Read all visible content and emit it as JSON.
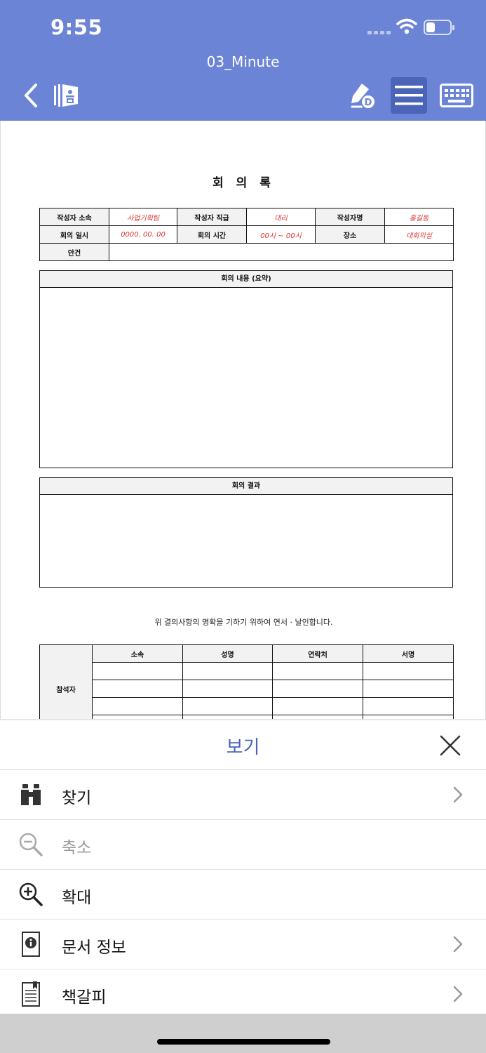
{
  "status_bar": {
    "time": "9:55",
    "battery_level": 0.35
  },
  "toolbar": {
    "document_title": "03_Minute"
  },
  "document": {
    "heading": "회 의 록",
    "info_table": {
      "row1": [
        "작성자 소속",
        "사업기획팀",
        "작성자 직급",
        "대리",
        "작성자명",
        "홍길동"
      ],
      "row2": [
        "회의 일시",
        "0000. 00. 00",
        "회의 시간",
        "00시 ~ 00시",
        "장소",
        "대회의실"
      ],
      "agenda_label": "안건"
    },
    "summary_header": "회의 내용 (요약)",
    "result_header": "회의 결과",
    "statement": "위 결의사항의 명확을 기하기 위하여 연서 · 날인합니다.",
    "attendee_table": {
      "label": "참석자",
      "headers": [
        "소속",
        "성명",
        "연락처",
        "서명"
      ]
    }
  },
  "sheet": {
    "title": "보기",
    "items": [
      {
        "label": "찾기",
        "icon": "binoculars-icon",
        "has_arrow": true,
        "disabled": false
      },
      {
        "label": "축소",
        "icon": "zoom-out-icon",
        "has_arrow": false,
        "disabled": true
      },
      {
        "label": "확대",
        "icon": "zoom-in-icon",
        "has_arrow": false,
        "disabled": false
      },
      {
        "label": "문서 정보",
        "icon": "document-info-icon",
        "has_arrow": true,
        "disabled": false
      },
      {
        "label": "책갈피",
        "icon": "bookmark-icon",
        "has_arrow": true,
        "disabled": false
      }
    ]
  },
  "colors": {
    "toolbar": "#6b84d6",
    "accent": "#4a63b6",
    "red_text": "#d33333"
  }
}
